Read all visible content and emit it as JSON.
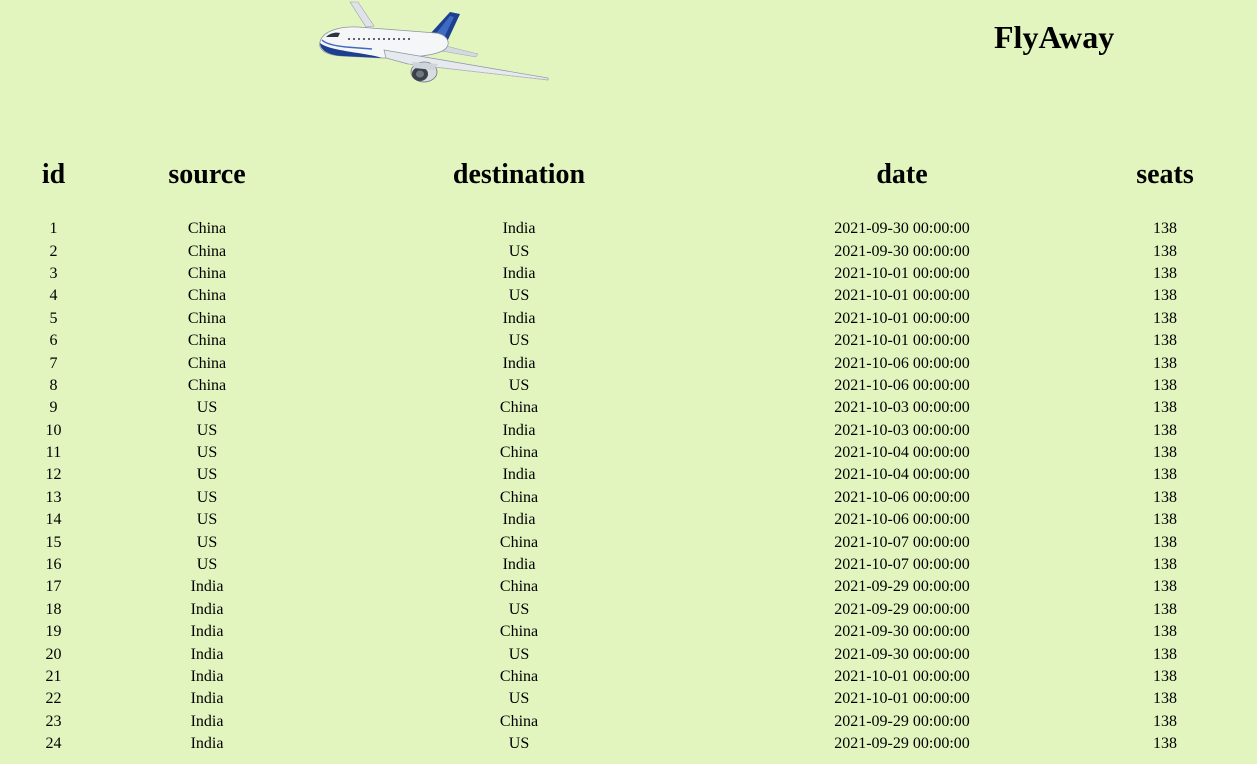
{
  "header": {
    "brand": "FlyAway",
    "logo_icon": "airplane-icon"
  },
  "table": {
    "columns": [
      "id",
      "source",
      "destination",
      "date",
      "seats"
    ],
    "rows": [
      [
        "1",
        "China",
        "India",
        "2021-09-30 00:00:00",
        "138"
      ],
      [
        "2",
        "China",
        "US",
        "2021-09-30 00:00:00",
        "138"
      ],
      [
        "3",
        "China",
        "India",
        "2021-10-01 00:00:00",
        "138"
      ],
      [
        "4",
        "China",
        "US",
        "2021-10-01 00:00:00",
        "138"
      ],
      [
        "5",
        "China",
        "India",
        "2021-10-01 00:00:00",
        "138"
      ],
      [
        "6",
        "China",
        "US",
        "2021-10-01 00:00:00",
        "138"
      ],
      [
        "7",
        "China",
        "India",
        "2021-10-06 00:00:00",
        "138"
      ],
      [
        "8",
        "China",
        "US",
        "2021-10-06 00:00:00",
        "138"
      ],
      [
        "9",
        "US",
        "China",
        "2021-10-03 00:00:00",
        "138"
      ],
      [
        "10",
        "US",
        "India",
        "2021-10-03 00:00:00",
        "138"
      ],
      [
        "11",
        "US",
        "China",
        "2021-10-04 00:00:00",
        "138"
      ],
      [
        "12",
        "US",
        "India",
        "2021-10-04 00:00:00",
        "138"
      ],
      [
        "13",
        "US",
        "China",
        "2021-10-06 00:00:00",
        "138"
      ],
      [
        "14",
        "US",
        "India",
        "2021-10-06 00:00:00",
        "138"
      ],
      [
        "15",
        "US",
        "China",
        "2021-10-07 00:00:00",
        "138"
      ],
      [
        "16",
        "US",
        "India",
        "2021-10-07 00:00:00",
        "138"
      ],
      [
        "17",
        "India",
        "China",
        "2021-09-29 00:00:00",
        "138"
      ],
      [
        "18",
        "India",
        "US",
        "2021-09-29 00:00:00",
        "138"
      ],
      [
        "19",
        "India",
        "China",
        "2021-09-30 00:00:00",
        "138"
      ],
      [
        "20",
        "India",
        "US",
        "2021-09-30 00:00:00",
        "138"
      ],
      [
        "21",
        "India",
        "China",
        "2021-10-01 00:00:00",
        "138"
      ],
      [
        "22",
        "India",
        "US",
        "2021-10-01 00:00:00",
        "138"
      ],
      [
        "23",
        "India",
        "China",
        "2021-09-29 00:00:00",
        "138"
      ],
      [
        "24",
        "India",
        "US",
        "2021-09-29 00:00:00",
        "138"
      ]
    ]
  },
  "colors": {
    "background": "#e2f5bf",
    "text": "#000000",
    "plane_body": "#f4f6f8",
    "plane_accent": "#1d3f8f"
  }
}
